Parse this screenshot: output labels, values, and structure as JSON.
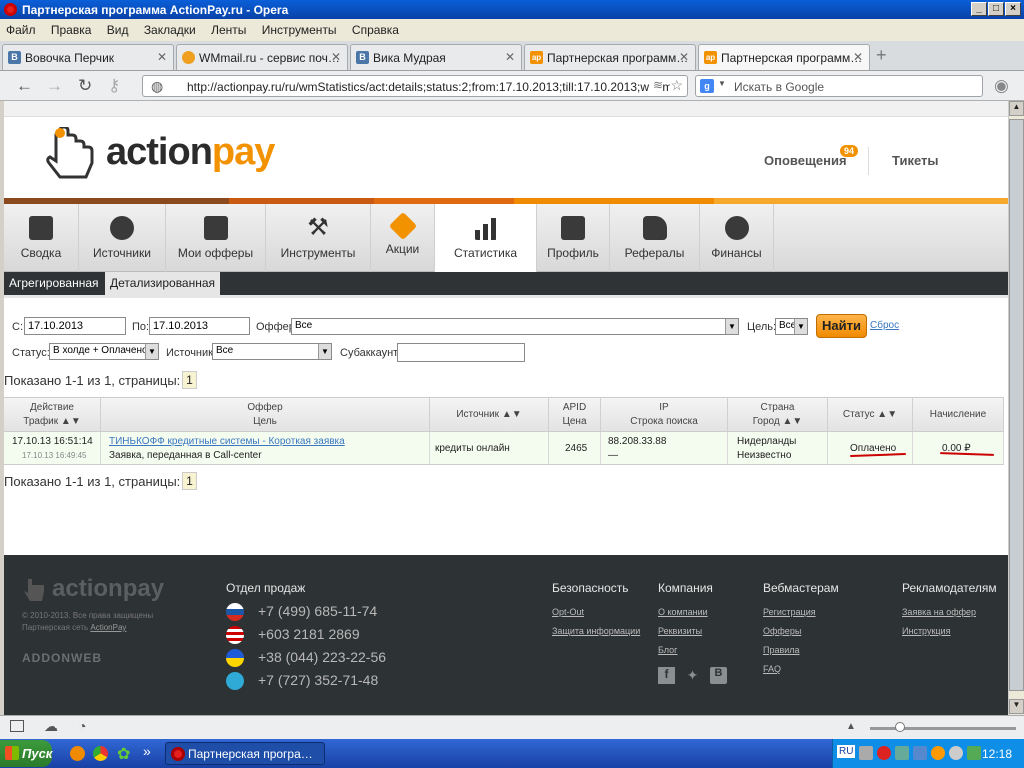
{
  "window": {
    "title": "Партнерская программа ActionPay.ru - Opera"
  },
  "menu": [
    "Файл",
    "Правка",
    "Вид",
    "Закладки",
    "Ленты",
    "Инструменты",
    "Справка"
  ],
  "tabs": [
    {
      "label": "Вовочка Перчик",
      "fav": "B",
      "color": "#4a76a8"
    },
    {
      "label": "WMmail.ru - сервис поч…",
      "fav": "",
      "color": "#f0a020"
    },
    {
      "label": "Вика Мудрая",
      "fav": "B",
      "color": "#4a76a8"
    },
    {
      "label": "Партнерская программ…",
      "fav": "ap",
      "color": "#f39200"
    },
    {
      "label": "Партнерская программ…",
      "fav": "ap",
      "color": "#f39200"
    }
  ],
  "url": "http://actionpay.ru/ru/wmStatistics/act:details;status:2;from:17.10.2013;till:17.10.2013;webm",
  "search_placeholder": "Искать в Google",
  "header": {
    "logo_part1": "action",
    "logo_part2": "pay",
    "notifications": "Оповещения",
    "notif_count": "94",
    "tickets": "Тикеты"
  },
  "nav": [
    "Сводка",
    "Источники",
    "Мои офферы",
    "Инструменты",
    "Акции",
    "Статистика",
    "Профиль",
    "Рефералы",
    "Финансы"
  ],
  "subnav": [
    "Агрегированная",
    "Детализированная"
  ],
  "filters": {
    "from_label": "С:",
    "from_value": "17.10.2013",
    "to_label": "По:",
    "to_value": "17.10.2013",
    "offer_label": "Оффер:",
    "offer_value": "Все",
    "goal_label": "Цель:",
    "goal_value": "Все",
    "find_button": "Найти",
    "reset_link": "Сброс",
    "status_label": "Статус:",
    "status_value": "В холде + Оплачено",
    "source_label": "Источник:",
    "source_value": "Все",
    "subaccount_label": "Субаккаунт:"
  },
  "shown_text": "Показано 1-1 из 1, страницы:",
  "page_number": "1",
  "table": {
    "headers": [
      {
        "l1": "Действие",
        "l2": "Трафик ▲▼"
      },
      {
        "l1": "Оффер",
        "l2": "Цель"
      },
      {
        "l1": "Источник ▲▼",
        "l2": ""
      },
      {
        "l1": "APID",
        "l2": "Цена"
      },
      {
        "l1": "IP",
        "l2": "Строка поиска"
      },
      {
        "l1": "Страна",
        "l2": "Город ▲▼"
      },
      {
        "l1": "Статус ▲▼",
        "l2": ""
      },
      {
        "l1": "Начисление",
        "l2": ""
      }
    ],
    "row": {
      "action_time": "17.10.13 16:51:14",
      "traffic_time": "17.10.13 16:49:45",
      "offer": "ТИНЬКОФФ кредитные системы - Короткая заявка",
      "goal": "Заявка, переданная в Call-center",
      "source": "кредиты онлайн",
      "apid": "2465",
      "ip": "88.208.33.88",
      "search": "—",
      "country": "Нидерланды",
      "city": "Неизвестно",
      "status": "Оплачено",
      "amount": "0.00 ₽"
    }
  },
  "footer": {
    "copyright": "© 2010-2013. Все права защищены",
    "partner": "Партнерская сеть",
    "partner_link": "ActionPay",
    "addon": "ADDONWEB",
    "sales_title": "Отдел продаж",
    "phones": [
      "+7 (499) 685-11-74",
      "+603 2181 2869",
      "+38 (044) 223-22-56",
      "+7 (727) 352-71-48"
    ],
    "cols": [
      {
        "title": "Безопасность",
        "links": [
          "Opt-Out",
          "Защита информации"
        ]
      },
      {
        "title": "Компания",
        "links": [
          "О компании",
          "Реквизиты",
          "Блог"
        ]
      },
      {
        "title": "Вебмастерам",
        "links": [
          "Регистрация",
          "Офферы",
          "Правила",
          "FAQ"
        ]
      },
      {
        "title": "Рекламодателям",
        "links": [
          "Заявка на оффер",
          "Инструкция"
        ]
      }
    ]
  },
  "taskbar": {
    "start": "Пуск",
    "task": "Партнерская програ…",
    "lang": "RU",
    "clock": "12:18"
  }
}
